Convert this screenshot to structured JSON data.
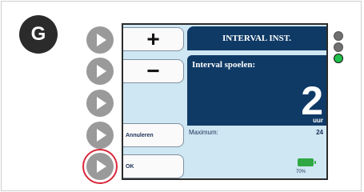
{
  "step_label": "G",
  "screen": {
    "plus_label": "+",
    "minus_label": "−",
    "cancel_label": "Annuleren",
    "ok_label": "OK",
    "title": "INTERVAL INST.",
    "interval_label": "Interval spoelen:",
    "interval_value": "2",
    "interval_unit": "uur",
    "maximum_label": "Maximum:",
    "maximum_value": "24",
    "battery_percent": "70%"
  },
  "leds": [
    "grey",
    "grey",
    "green"
  ],
  "colors": {
    "accent": "#0f3a66",
    "screen_bg": "#cfe7f3",
    "highlight_ring": "#d9283b",
    "led_active": "#20c04a"
  }
}
